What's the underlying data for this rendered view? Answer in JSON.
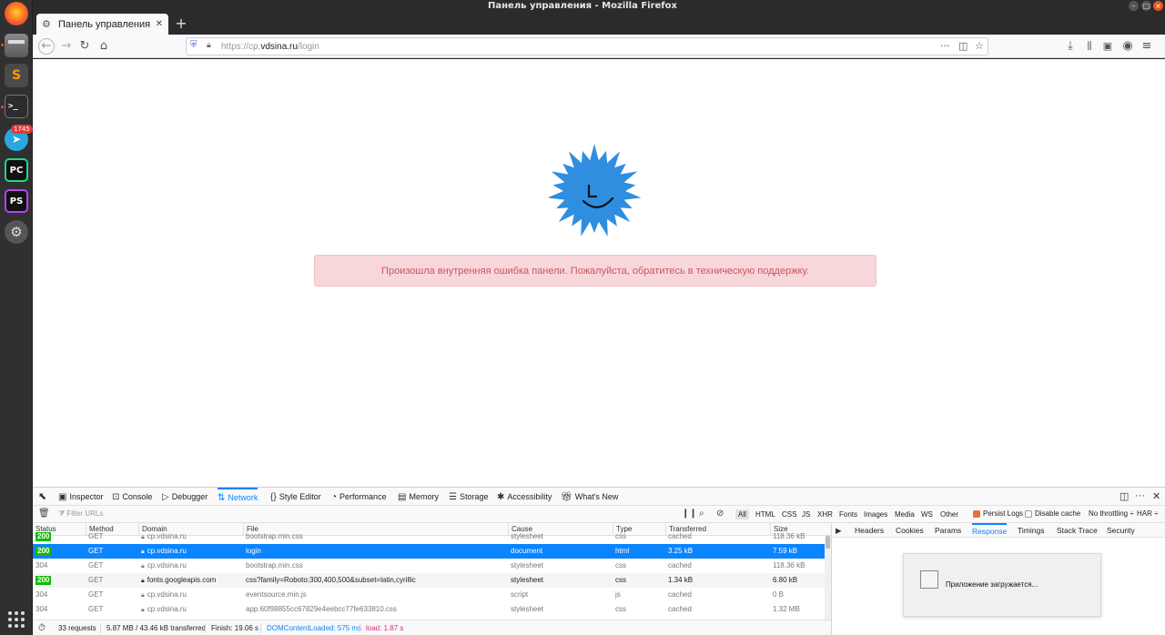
{
  "window": {
    "title": "Панель управления - Mozilla Firefox"
  },
  "dock": {
    "telegram_badge": "1745",
    "apps": [
      "firefox-icon",
      "files-icon",
      "sublime-text-icon",
      "terminal-icon",
      "telegram-icon",
      "pycharm-icon",
      "phpstorm-icon",
      "settings-icon"
    ],
    "labels": {
      "pycharm": "PC",
      "phpstorm": "PS",
      "sublime": "S"
    }
  },
  "tab": {
    "title": "Панель управления",
    "close": "✕",
    "new": "+"
  },
  "urlbar": {
    "scheme": "https://cp.",
    "domain": "vdsina.ru",
    "path": "/login"
  },
  "page": {
    "error_message": "Произошла внутренняя ошибка панели. Пожалуйста, обратитесь в техническую поддержку."
  },
  "devtools": {
    "tabs": [
      "Inspector",
      "Console",
      "Debugger",
      "Network",
      "Style Editor",
      "Performance",
      "Memory",
      "Storage",
      "Accessibility",
      "What's New"
    ],
    "active_tab": "Network",
    "filter_placeholder": "Filter URLs",
    "filter_types": [
      "All",
      "HTML",
      "CSS",
      "JS",
      "XHR",
      "Fonts",
      "Images",
      "Media",
      "WS",
      "Other"
    ],
    "persist_logs": "Persist Logs",
    "disable_cache": "Disable cache",
    "throttling": "No throttling ÷",
    "har": "HAR ÷",
    "columns": [
      "Status",
      "Method",
      "Domain",
      "File",
      "Cause",
      "Type",
      "Transferred",
      "Size"
    ],
    "rows": [
      {
        "status": "200",
        "method": "GET",
        "domain": "cp.vdsina.ru",
        "file": "bootstrap.min.css",
        "cause": "stylesheet",
        "type": "css",
        "transferred": "cached",
        "size": "118.36 kB",
        "secure": true
      },
      {
        "status": "200",
        "method": "GET",
        "domain": "cp.vdsina.ru",
        "file": "login",
        "cause": "document",
        "type": "html",
        "transferred": "3.25 kB",
        "size": "7.59 kB",
        "secure": true
      },
      {
        "status": "304",
        "method": "GET",
        "domain": "cp.vdsina.ru",
        "file": "bootstrap.min.css",
        "cause": "stylesheet",
        "type": "css",
        "transferred": "cached",
        "size": "118.36 kB",
        "secure": true
      },
      {
        "status": "200",
        "method": "GET",
        "domain": "fonts.googleapis.com",
        "file": "css?family=Roboto:300,400,500&subset=latin,cyrillic",
        "cause": "stylesheet",
        "type": "css",
        "transferred": "1.34 kB",
        "size": "6.80 kB",
        "secure": true
      },
      {
        "status": "304",
        "method": "GET",
        "domain": "cp.vdsina.ru",
        "file": "eventsource.min.js",
        "cause": "script",
        "type": "js",
        "transferred": "cached",
        "size": "0 B",
        "secure": true
      },
      {
        "status": "304",
        "method": "GET",
        "domain": "cp.vdsina.ru",
        "file": "app.60f98855cc67829e4eebcc77fe633810.css",
        "cause": "stylesheet",
        "type": "css",
        "transferred": "cached",
        "size": "1.32 MB",
        "secure": true
      }
    ],
    "selected_row": 1,
    "status_bar": {
      "requests": "33 requests",
      "transferred": "5.87 MB / 43.46 kB transferred",
      "finish": "Finish: 19.06 s",
      "domcontentloaded": "DOMContentLoaded: 575 ms",
      "load": "load: 1.87 s"
    },
    "side_tabs": [
      "Headers",
      "Cookies",
      "Params",
      "Response",
      "Timings",
      "Stack Trace",
      "Security"
    ],
    "side_active": "Response",
    "loading_text": "Приложение загружается..."
  },
  "colors": {
    "accent": "#0a84ff",
    "alert_bg": "#f8d7da",
    "alert_text": "#c9555f",
    "logo": "#2f8ee0",
    "status_ok": "#12bc00"
  }
}
